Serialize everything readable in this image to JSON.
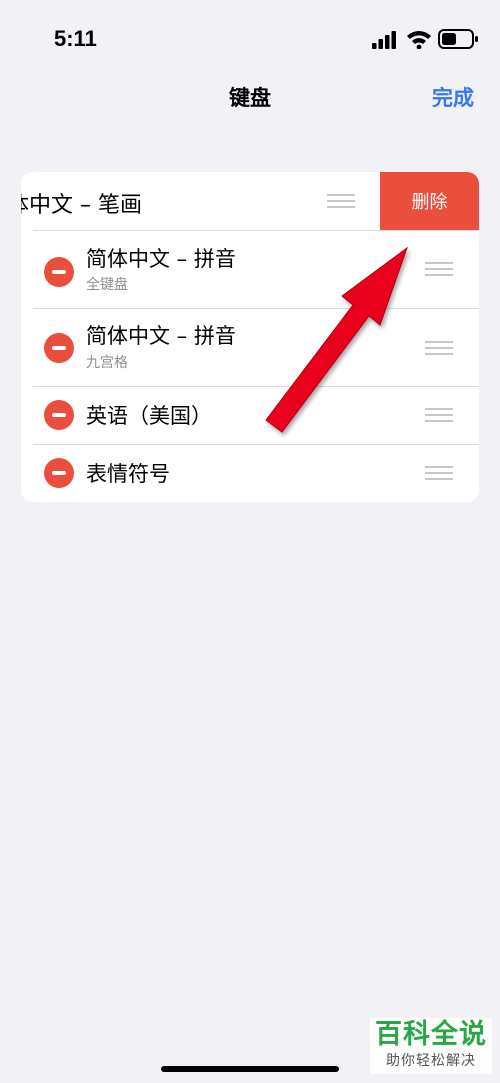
{
  "status_bar": {
    "time": "5:11",
    "icons": [
      "signal-icon",
      "wifi-icon",
      "battery-icon"
    ]
  },
  "nav": {
    "title": "键盘",
    "done_label": "完成",
    "done_color": "#3478f6"
  },
  "keyboards": {
    "swiped_row": {
      "label": "体中文 – 笔画",
      "delete_label": "删除"
    },
    "items": [
      {
        "title": "简体中文 – 拼音",
        "subtitle": "全键盘"
      },
      {
        "title": "简体中文 – 拼音",
        "subtitle": "九宫格"
      },
      {
        "title": "英语（美国）"
      },
      {
        "title": "表情符号"
      }
    ]
  },
  "colors": {
    "delete_red": "#ea4e3d",
    "background": "#f2f1f6",
    "annotation_arrow": "#e8001c"
  },
  "watermark": {
    "main": "百科全说",
    "sub": "助你轻松解决"
  }
}
